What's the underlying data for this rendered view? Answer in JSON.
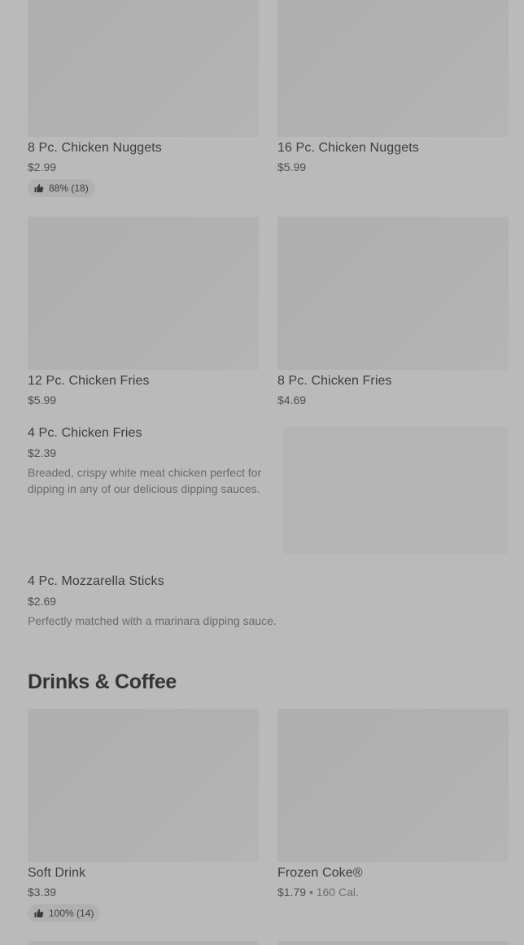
{
  "items": {
    "nuggets8": {
      "name": "8 Pc. Chicken Nuggets",
      "price": "$2.99",
      "rating": "88% (18)"
    },
    "nuggets16": {
      "name": "16 Pc. Chicken Nuggets",
      "price": "$5.99"
    },
    "fries12": {
      "name": "12 Pc. Chicken Fries",
      "price": "$5.99"
    },
    "fries8": {
      "name": "8 Pc. Chicken Fries",
      "price": "$4.69"
    },
    "fries4": {
      "name": "4 Pc. Chicken Fries",
      "price": "$2.39",
      "description": "Breaded, crispy white meat chicken perfect for dipping in any of our delicious dipping sauces."
    },
    "mozz": {
      "name": "4 Pc. Mozzarella Sticks",
      "price": "$2.69",
      "description": "Perfectly matched with a marinara dipping sauce."
    }
  },
  "drinks": {
    "title": "Drinks & Coffee",
    "soft": {
      "name": "Soft Drink",
      "price": "$3.39",
      "rating": "100% (14)"
    },
    "frozen": {
      "name": "Frozen Coke®",
      "price": "$1.79",
      "separator": "•",
      "calories": "160 Cal."
    }
  },
  "icons": {
    "rating": "thumbs-up-icon"
  },
  "colors": {
    "background": "#bababa",
    "image_placeholder": "#b0b0b0",
    "text_primary": "#3e3e3e",
    "text_secondary": "#6a6a6a"
  }
}
